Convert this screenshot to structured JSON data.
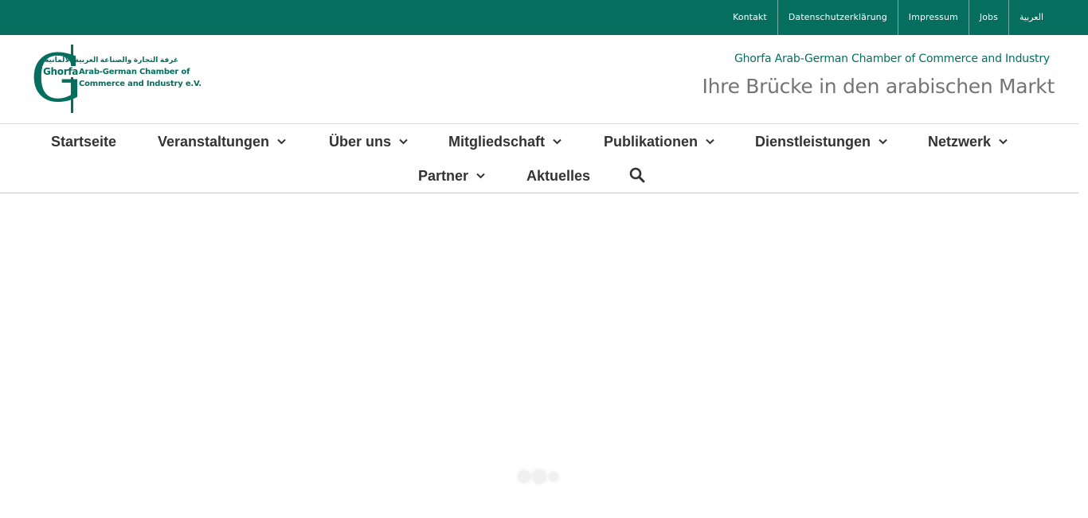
{
  "top_bar": {
    "links": [
      "Kontakt",
      "Datenschutzerklärung",
      "Impressum",
      "Jobs",
      "العربية"
    ]
  },
  "logo": {
    "letter": "G",
    "ghorfa": "Ghorfa",
    "arabic": "غرفة التجارة والصناعة العربية الألمانية",
    "line1": "Arab-German Chamber of",
    "line2": "Commerce and Industry e.V."
  },
  "header": {
    "subtitle": "Ghorfa Arab-German Chamber of Commerce and Industry",
    "tagline": "Ihre Brücke in den arabischen Markt"
  },
  "main_nav": {
    "items": [
      {
        "label": "Startseite",
        "has_dropdown": false
      },
      {
        "label": "Veranstaltungen",
        "has_dropdown": true
      },
      {
        "label": "Über uns",
        "has_dropdown": true
      },
      {
        "label": "Mitgliedschaft",
        "has_dropdown": true
      },
      {
        "label": "Publikationen",
        "has_dropdown": true
      },
      {
        "label": "Dienstleistungen",
        "has_dropdown": true
      },
      {
        "label": "Netzwerk",
        "has_dropdown": true
      },
      {
        "label": "Partner",
        "has_dropdown": true
      },
      {
        "label": "Aktuelles",
        "has_dropdown": false
      }
    ],
    "search_icon": "search-icon"
  },
  "colors": {
    "brand": "#066e5f",
    "nav_text": "#333333",
    "tagline": "#747474"
  }
}
